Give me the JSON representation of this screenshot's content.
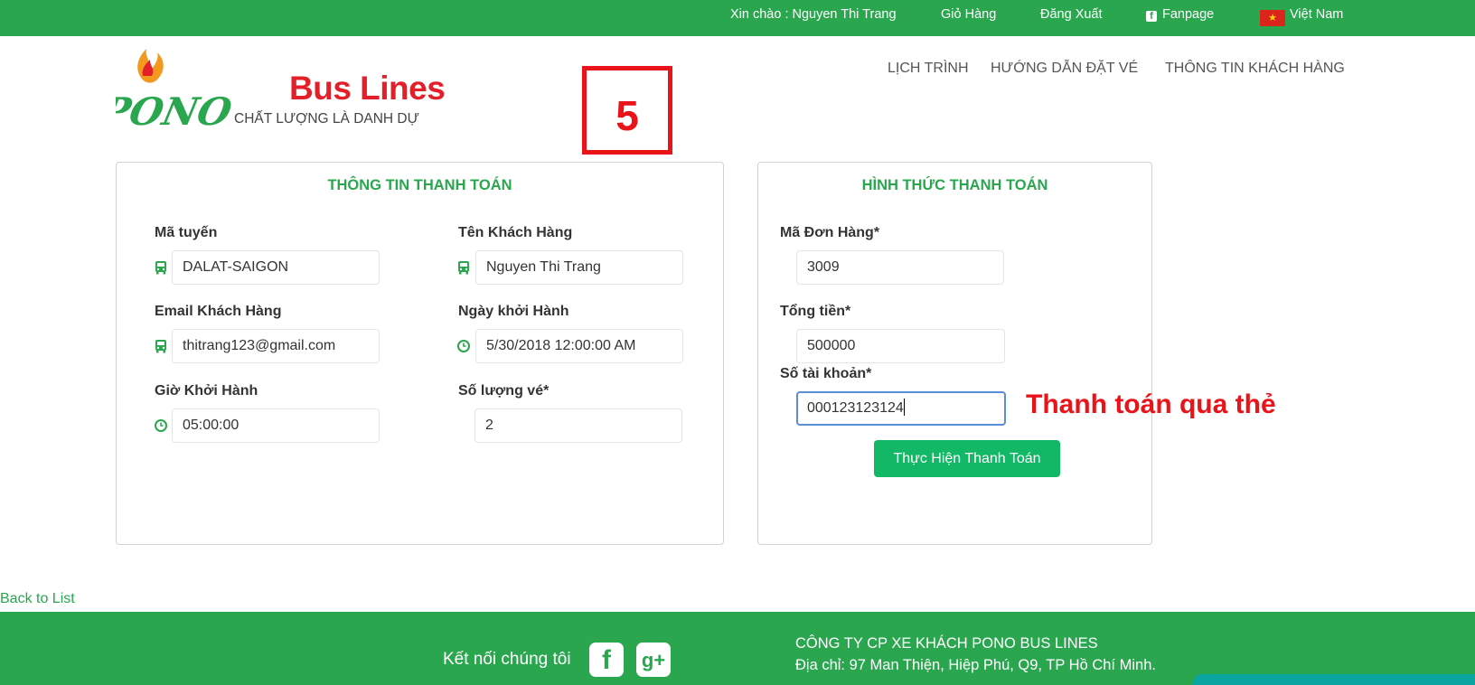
{
  "topbar": {
    "greeting": "Xin chào : Nguyen Thi Trang",
    "cart": "Giỏ Hàng",
    "logout": "Đăng Xuất",
    "fanpage": "Fanpage",
    "language": "Việt Nam",
    "icons": {
      "fanpage": "facebook-icon",
      "language": "vietnam-flag-icon"
    }
  },
  "logo": {
    "mark_text": "PONO",
    "brand": "Bus Lines",
    "slogan": "CHẤT LƯỢNG LÀ DANH DỰ",
    "colors": {
      "green": "#2aa64f",
      "red": "#e3202a"
    }
  },
  "nav": {
    "items": [
      "LỊCH TRÌNH",
      "HƯỚNG DẪN ĐẶT VÉ",
      "THÔNG TIN KHÁCH HÀNG"
    ]
  },
  "annotation": {
    "step": "5",
    "note": "Thanh toán qua thẻ",
    "color": "#e8141a"
  },
  "payment_info": {
    "title": "THÔNG TIN THANH TOÁN",
    "fields": [
      {
        "label": "Mã tuyến",
        "value": "DALAT-SAIGON",
        "icon": "bus-icon"
      },
      {
        "label": "Tên Khách Hàng",
        "value": "Nguyen Thi Trang",
        "icon": "bus-icon"
      },
      {
        "label": "Email Khách Hàng",
        "value": "thitrang123@gmail.com",
        "icon": "bus-icon"
      },
      {
        "label": "Ngày khởi Hành",
        "value": "5/30/2018 12:00:00 AM",
        "icon": "clock-icon"
      },
      {
        "label": "Giờ Khởi Hành",
        "value": "05:00:00",
        "icon": "clock-icon"
      },
      {
        "label": "Số lượng vé*",
        "value": "2"
      }
    ]
  },
  "payment_method": {
    "title": "HÌNH THỨC THANH TOÁN",
    "fields": [
      {
        "label": "Mã Đơn Hàng*",
        "value": "3009"
      },
      {
        "label": "Tổng tiền*",
        "value": "500000"
      },
      {
        "label": "Số tài khoản*",
        "value": "000123123124"
      }
    ],
    "submit": "Thực Hiện Thanh Toán"
  },
  "back_link": "Back to List",
  "footer": {
    "connect": "Kết nối chúng tôi",
    "social_icons": [
      "facebook-icon",
      "google-plus-icon"
    ],
    "company": "CÔNG TY CP XE KHÁCH PONO BUS LINES",
    "address": "Địa chỉ: 97 Man Thiện, Hiệp Phú, Q9, TP Hồ Chí Minh."
  },
  "colors": {
    "primary_green": "#2aa64f",
    "button_green": "#12b866",
    "focus_border": "#5b8ed9"
  }
}
